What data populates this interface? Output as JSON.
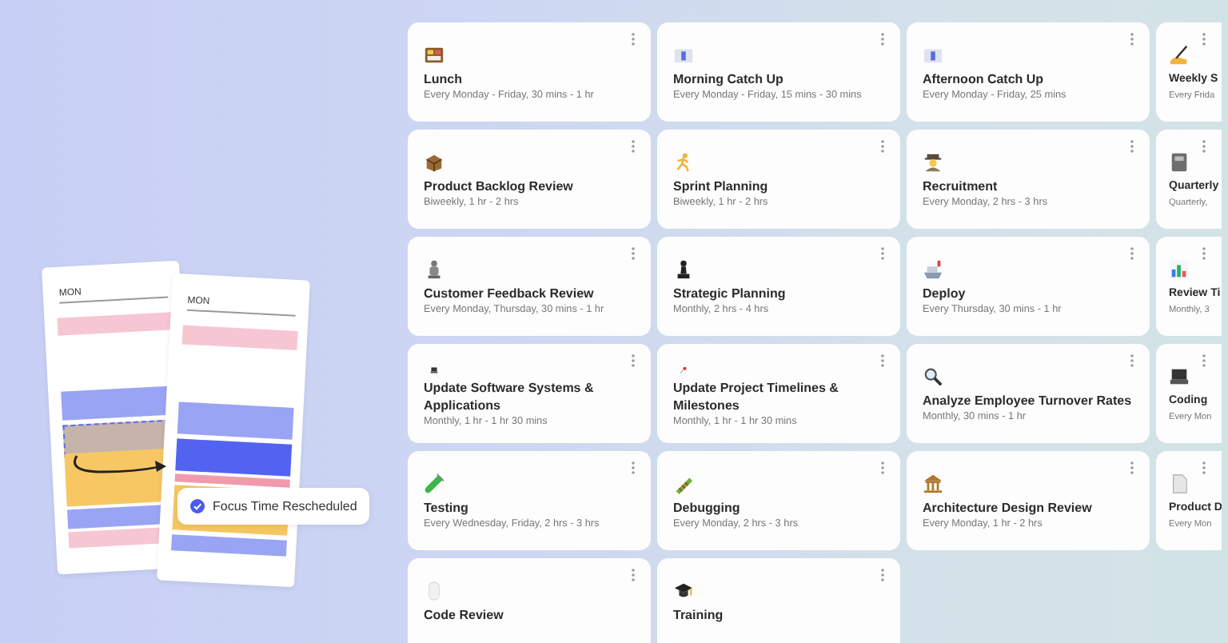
{
  "illustration": {
    "day_labels": [
      "MON",
      "MON"
    ],
    "toast": "Focus Time Rescheduled"
  },
  "cards": [
    {
      "title": "Lunch",
      "schedule": "Every Monday - Friday, 30 mins - 1 hr"
    },
    {
      "title": "Morning Catch Up",
      "schedule": "Every Monday - Friday, 15 mins - 30 mins"
    },
    {
      "title": "Afternoon Catch Up",
      "schedule": "Every Monday - Friday, 25 mins"
    },
    {
      "title": "Weekly S",
      "schedule": "Every Frida"
    },
    {
      "title": "Product Backlog Review",
      "schedule": "Biweekly, 1 hr - 2 hrs"
    },
    {
      "title": "Sprint Planning",
      "schedule": "Biweekly, 1 hr - 2 hrs"
    },
    {
      "title": "Recruitment",
      "schedule": "Every Monday, 2 hrs - 3 hrs"
    },
    {
      "title": "Quarterly",
      "schedule": "Quarterly,"
    },
    {
      "title": "Customer Feedback Review",
      "schedule": "Every Monday, Thursday, 30 mins - 1 hr"
    },
    {
      "title": "Strategic Planning",
      "schedule": "Monthly, 2 hrs - 4 hrs"
    },
    {
      "title": "Deploy",
      "schedule": "Every Thursday, 30 mins - 1 hr"
    },
    {
      "title": "Review Ti",
      "schedule": "Monthly, 3"
    },
    {
      "title": "Update Software Systems & Applications",
      "schedule": "Monthly, 1 hr - 1 hr 30 mins"
    },
    {
      "title": "Update Project Timelines & Milestones",
      "schedule": "Monthly, 1 hr - 1 hr 30 mins"
    },
    {
      "title": "Analyze Employee Turnover Rates",
      "schedule": "Monthly, 30 mins - 1 hr"
    },
    {
      "title": "Coding",
      "schedule": "Every Mon"
    },
    {
      "title": "Testing",
      "schedule": "Every Wednesday, Friday, 2 hrs - 3 hrs"
    },
    {
      "title": "Debugging",
      "schedule": "Every Monday, 2 hrs - 3 hrs"
    },
    {
      "title": "Architecture Design Review",
      "schedule": "Every Monday, 1 hr - 2 hrs"
    },
    {
      "title": "Product D",
      "schedule": "Every Mon"
    },
    {
      "title": "Code Review"
    },
    {
      "title": "Training"
    }
  ]
}
